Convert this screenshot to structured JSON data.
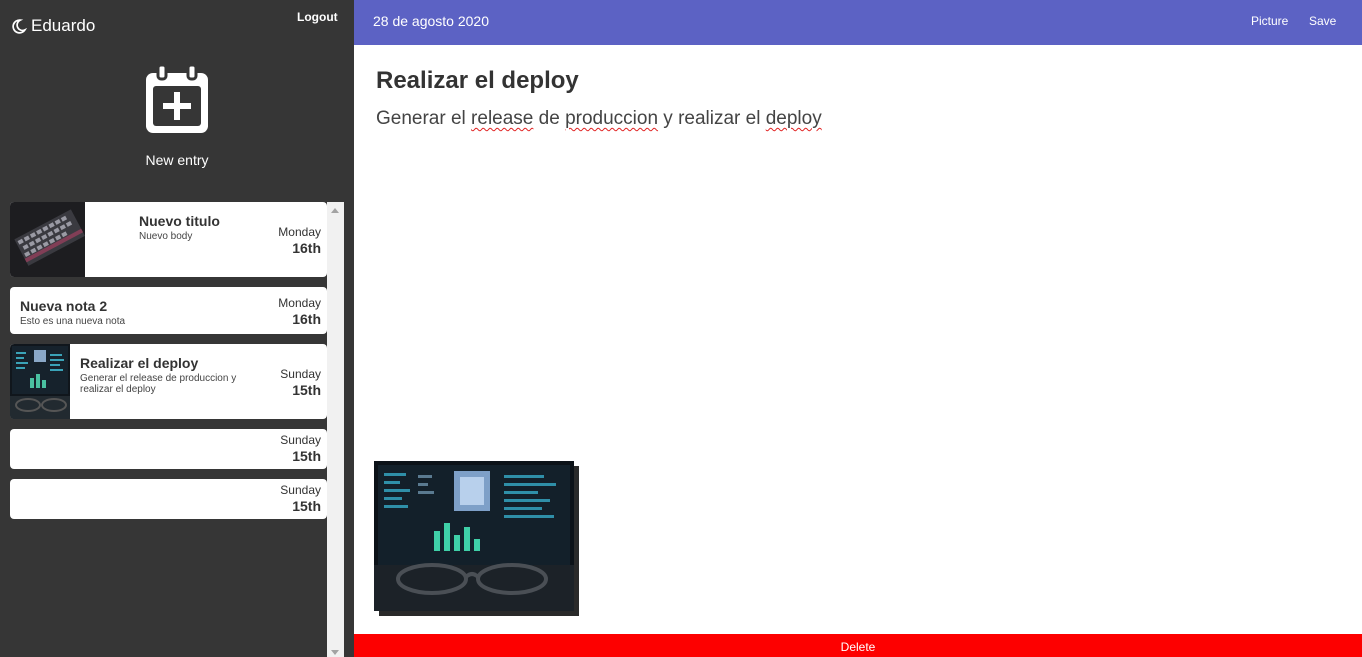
{
  "sidebar": {
    "user_name": "Eduardo",
    "logout_label": "Logout",
    "new_entry_label": "New entry",
    "entries": [
      {
        "title": "Nuevo titulo",
        "body": "Nuevo body",
        "day": "Monday",
        "date": "16th",
        "has_image": true
      },
      {
        "title": "Nueva nota 2",
        "body": "Esto es una nueva nota",
        "day": "Monday",
        "date": "16th",
        "has_image": false
      },
      {
        "title": "Realizar el deploy",
        "body": "Generar el release de produccion y realizar el deploy",
        "day": "Sunday",
        "date": "15th",
        "has_image": true
      },
      {
        "title": "",
        "body": "",
        "day": "Sunday",
        "date": "15th",
        "has_image": false
      },
      {
        "title": "",
        "body": "",
        "day": "Sunday",
        "date": "15th",
        "has_image": false
      }
    ]
  },
  "topbar": {
    "date": "28 de agosto 2020",
    "picture_label": "Picture",
    "save_label": "Save"
  },
  "note": {
    "title": "Realizar el deploy",
    "body_words": [
      "Generar el ",
      "release",
      " de ",
      "produccion",
      " y realizar el ",
      "deploy"
    ]
  },
  "delete_label": "Delete",
  "colors": {
    "sidebar_bg": "#363636",
    "topbar_bg": "#5c62c4",
    "delete_bg": "#fd0000"
  },
  "icons": {
    "user": "moon-icon",
    "new_entry": "calendar-plus-icon"
  }
}
